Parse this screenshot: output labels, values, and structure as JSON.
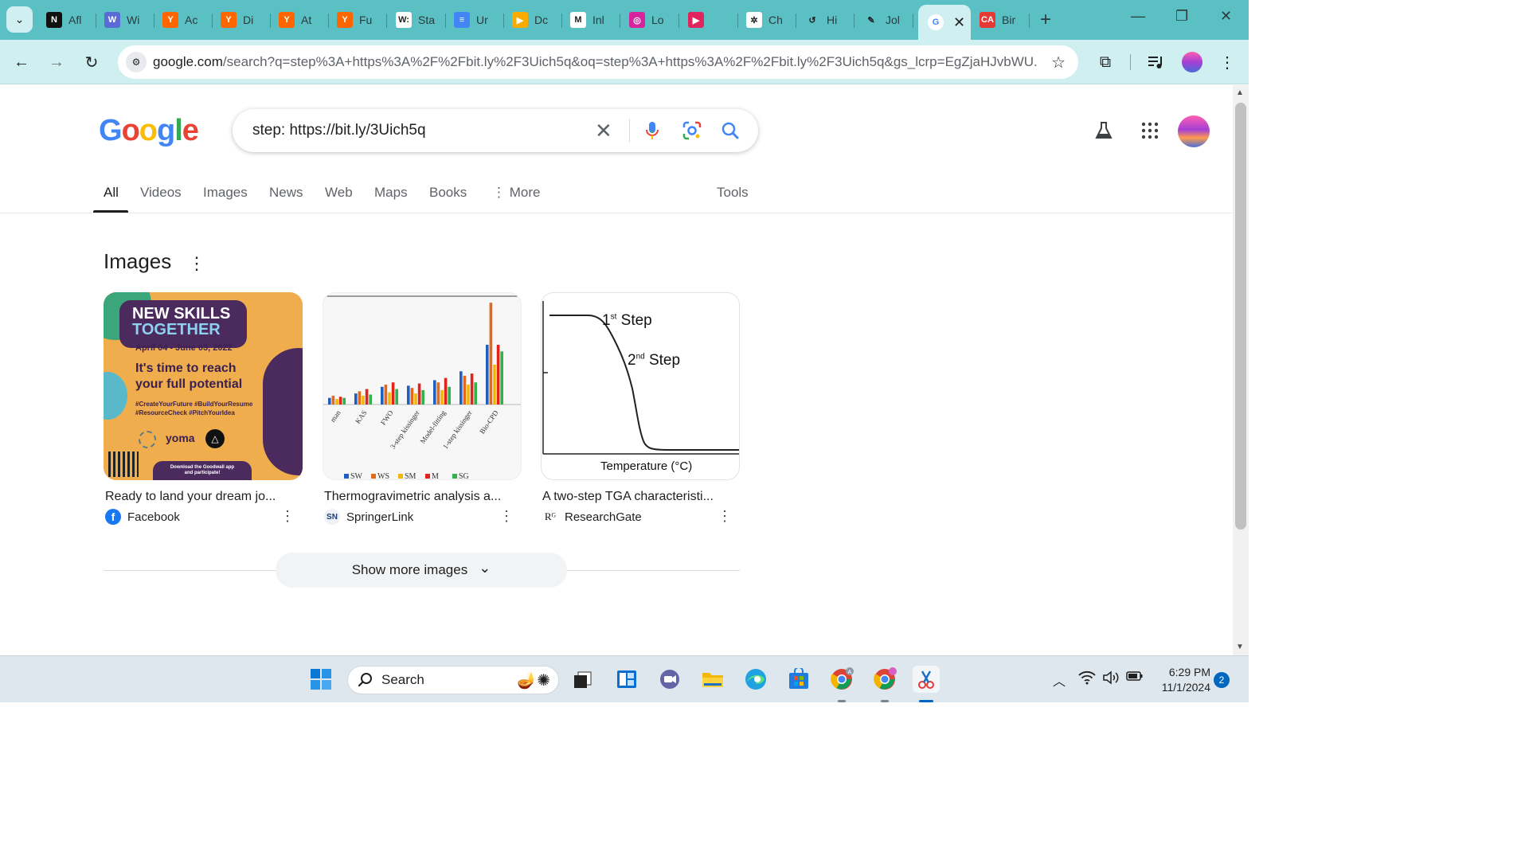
{
  "browser": {
    "tabs": [
      {
        "label": "Afl",
        "icon": "notion-icon",
        "favicon_text": "N",
        "color": "#111111"
      },
      {
        "label": "Wi",
        "icon": "wiki-icon",
        "favicon_text": "W",
        "color": "#5b6bd6"
      },
      {
        "label": "Ac",
        "icon": "ycombinator-icon",
        "favicon_text": "Y",
        "color": "#ff6600"
      },
      {
        "label": "Di",
        "icon": "ycombinator-icon",
        "favicon_text": "Y",
        "color": "#ff6600"
      },
      {
        "label": "At",
        "icon": "ycombinator-icon",
        "favicon_text": "Y",
        "color": "#ff6600"
      },
      {
        "label": "Fu",
        "icon": "ycombinator-icon",
        "favicon_text": "Y",
        "color": "#ff6600"
      },
      {
        "label": "Sta",
        "icon": "wikipedia-icon",
        "favicon_text": "W:",
        "color": "#ffffff"
      },
      {
        "label": "Ur",
        "icon": "docs-icon",
        "favicon_text": "≡",
        "color": "#4285f4"
      },
      {
        "label": "Dc",
        "icon": "play-icon",
        "favicon_text": "▶",
        "color": "#f9ab00"
      },
      {
        "label": "Inl",
        "icon": "gmail-icon",
        "favicon_text": "M",
        "color": "#ffffff"
      },
      {
        "label": "Lo",
        "icon": "instagram-icon",
        "favicon_text": "◎",
        "color": "#d6249f"
      },
      {
        "label": "",
        "icon": "youtube-audio-icon",
        "favicon_text": "▶",
        "color": "#e0245e"
      },
      {
        "label": "Ch",
        "icon": "chatgpt-icon",
        "favicon_text": "✲",
        "color": "#ffffff"
      },
      {
        "label": "Hi",
        "icon": "history-icon",
        "favicon_text": "↺",
        "color": "#5bc0c4"
      },
      {
        "label": "Jol",
        "icon": "leaf-icon",
        "favicon_text": "✎",
        "color": "#5bc0c4"
      },
      {
        "label": "Bir",
        "icon": "ca-icon",
        "favicon_text": "CA",
        "color": "#e53935"
      }
    ],
    "active_tab": {
      "icon": "google-icon",
      "favicon_text": "G",
      "close": "✕"
    },
    "new_tab": "+",
    "url_host": "google.com",
    "url_rest": "/search?q=step%3A+https%3A%2F%2Fbit.ly%2F3Uich5q&oq=step%3A+https%3A%2F%2Fbit.ly%2F3Uich5q&gs_lcrp=EgZjaHJvbWU...",
    "icons": {
      "back": "←",
      "forward": "→",
      "reload": "↻",
      "star": "☆",
      "extensions": "⧉",
      "menu": "⋮"
    }
  },
  "page": {
    "logo": [
      "G",
      "o",
      "o",
      "g",
      "l",
      "e"
    ],
    "logo_colors": [
      "#4285f4",
      "#ea4335",
      "#fbbc05",
      "#4285f4",
      "#34a853",
      "#ea4335"
    ],
    "search_query": "step: https://bit.ly/3Uich5q",
    "clear": "✕",
    "nav_tabs": [
      "All",
      "Videos",
      "Images",
      "News",
      "Web",
      "Maps",
      "Books",
      "More"
    ],
    "more_dots": "⋮",
    "tools": "Tools",
    "images_section_title": "Images",
    "section_menu": "⋮",
    "results": [
      {
        "title": "Ready to land your dream jo...",
        "source": "Facebook",
        "source_icon": "f",
        "thumb": {
          "heading_line1": "NEW SKILLS",
          "heading_line2": "TOGETHER",
          "date": "April 04 - June 03, 2022",
          "tagline_line1": "It's time to reach",
          "tagline_line2": "your full potential",
          "hashtags_line1": "#CreateYourFuture #BuildYourResume",
          "hashtags_line2": "#ResourceCheck   #PitchYourIdea",
          "brand": "yoma",
          "cta_line1": "Download the Goodwall app",
          "cta_line2": "and participate!"
        }
      },
      {
        "title": "Thermogravimetric analysis a...",
        "source": "SpringerLink",
        "source_icon": "SN",
        "thumb": {
          "x_labels": [
            "man",
            "KAS",
            "FWO",
            "3-step kissinger",
            "Model-fitting",
            "1-step kissinger",
            "Bio-CPD"
          ],
          "legend": [
            "SW",
            "WS",
            "SM",
            "M",
            "SG"
          ],
          "legend_colors": [
            "#1f5fbf",
            "#e36a1d",
            "#f2b705",
            "#e0241b",
            "#2fb34a"
          ],
          "values": [
            [
              6,
              8,
              5,
              7,
              6
            ],
            [
              10,
              12,
              8,
              14,
              9
            ],
            [
              16,
              18,
              11,
              20,
              14
            ],
            [
              17,
              15,
              10,
              19,
              13
            ],
            [
              22,
              20,
              13,
              24,
              16
            ],
            [
              30,
              26,
              18,
              28,
              20
            ],
            [
              54,
              92,
              36,
              54,
              48
            ]
          ]
        }
      },
      {
        "title": "A two-step TGA characteristi...",
        "source": "ResearchGate",
        "source_icon": "Rᴳ",
        "thumb": {
          "step1": "1",
          "step1_sup": "st",
          "step1_word": "Step",
          "step2": "2",
          "step2_sup": "nd",
          "step2_word": "Step",
          "xlabel": "Temperature (°C)"
        }
      }
    ],
    "show_more": "Show more images",
    "show_more_chevron": "⌄"
  },
  "taskbar": {
    "search_label": "Search",
    "time": "6:29 PM",
    "date": "11/1/2024",
    "notification_count": "2"
  }
}
